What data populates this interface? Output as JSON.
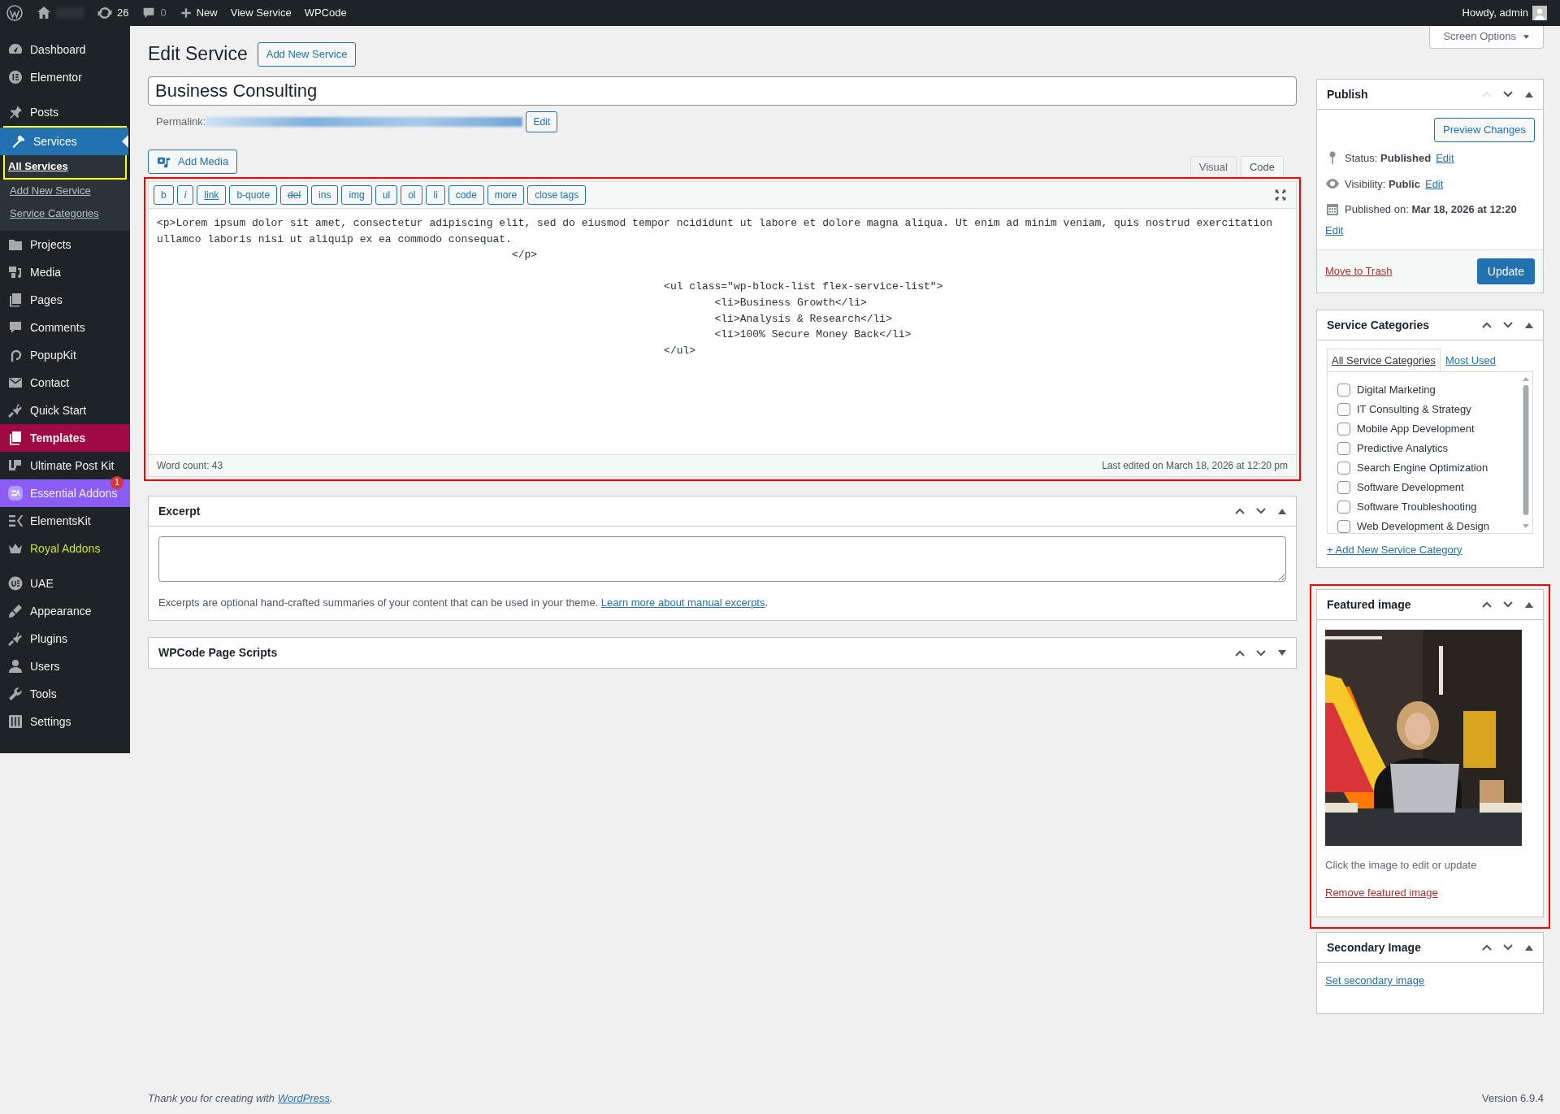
{
  "admin_bar": {
    "updates": "26",
    "comments": "0",
    "new": "New",
    "links": [
      "View Service",
      "WPCode"
    ],
    "greeting": "Howdy, admin"
  },
  "sidebar": {
    "groups": [
      {
        "items": [
          {
            "label": "Dashboard",
            "kind": "plain",
            "selected": false
          },
          {
            "label": "Elementor",
            "kind": "plain",
            "selected": false
          }
        ]
      },
      {
        "items": [
          {
            "label": "Posts",
            "kind": "plain",
            "selected": false
          },
          {
            "label": "Services",
            "kind": "plain",
            "selected": true,
            "highlighted": true,
            "children": [
              {
                "label": "All Services",
                "selected": true
              },
              {
                "label": "Add New Service",
                "selected": false
              },
              {
                "label": "Service Categories",
                "selected": false
              }
            ]
          },
          {
            "label": "Projects",
            "kind": "plain",
            "selected": false
          },
          {
            "label": "Media",
            "kind": "plain",
            "selected": false
          },
          {
            "label": "Pages",
            "kind": "plain",
            "selected": false
          },
          {
            "label": "Comments",
            "kind": "plain",
            "selected": false
          },
          {
            "label": "PopupKit",
            "kind": "plain",
            "selected": false
          },
          {
            "label": "Contact",
            "kind": "plain",
            "selected": false
          },
          {
            "label": "Quick Start",
            "kind": "plain",
            "selected": false
          },
          {
            "label": "Templates",
            "kind": "banner",
            "color": "#9e0a41",
            "selected": false
          },
          {
            "label": "Ultimate Post Kit",
            "kind": "plain",
            "selected": false
          },
          {
            "label": "Essential Addons",
            "kind": "banner",
            "color": "#8b5cf6",
            "badge": "1",
            "selected": false
          },
          {
            "label": "ElementsKit",
            "kind": "plain",
            "selected": false
          },
          {
            "label": "Royal Addons",
            "kind": "colored-text",
            "color": "#c7e23a",
            "selected": false
          }
        ]
      },
      {
        "items": [
          {
            "label": "UAE",
            "kind": "plain",
            "selected": false
          },
          {
            "label": "Appearance",
            "kind": "plain",
            "selected": false
          },
          {
            "label": "Plugins",
            "kind": "plain",
            "selected": false
          },
          {
            "label": "Users",
            "kind": "plain",
            "selected": false
          },
          {
            "label": "Tools",
            "kind": "plain",
            "selected": false
          },
          {
            "label": "Settings",
            "kind": "plain",
            "selected": false
          }
        ]
      }
    ]
  },
  "heading": "Edit Service",
  "add_new_button": "Add New Service",
  "screen_options": "Screen Options",
  "title_field": {
    "value": "Business Consulting"
  },
  "permalink": {
    "label": "Permalink:",
    "edit_button": "Edit"
  },
  "add_media": "Add Media",
  "editor": {
    "highlighted": true,
    "tabs": [
      {
        "label": "Visual",
        "selected": false
      },
      {
        "label": "Code",
        "selected": true
      }
    ],
    "quicktags": [
      {
        "label": "b",
        "kind": "plain"
      },
      {
        "label": "i",
        "kind": "italic"
      },
      {
        "label": "link",
        "kind": "underline"
      },
      {
        "label": "b-quote",
        "kind": "plain"
      },
      {
        "label": "del",
        "kind": "strike"
      },
      {
        "label": "ins",
        "kind": "plain"
      },
      {
        "label": "img",
        "kind": "plain"
      },
      {
        "label": "ul",
        "kind": "plain"
      },
      {
        "label": "ol",
        "kind": "plain"
      },
      {
        "label": "li",
        "kind": "plain"
      },
      {
        "label": "code",
        "kind": "plain"
      },
      {
        "label": "more",
        "kind": "plain"
      },
      {
        "label": "close tags",
        "kind": "plain"
      }
    ],
    "content": "<p>Lorem ipsum dolor sit amet, consectetur adipiscing elit, sed do eiusmod tempor ncididunt ut labore et dolore magna aliqua. Ut enim ad minim veniam, quis nostrud exercitation ullamco laboris nisi ut aliquip ex ea commodo consequat.\n\t\t\t\t\t\t\t</p>\n\n\t\t\t\t\t\t\t\t\t\t<ul class=\"wp-block-list flex-service-list\">\n\t\t\t\t\t\t\t\t\t\t\t<li>Business Growth</li>\n\t\t\t\t\t\t\t\t\t\t\t<li>Analysis & Research</li>\n\t\t\t\t\t\t\t\t\t\t\t<li>100% Secure Money Back</li>\n\t\t\t\t\t\t\t\t\t\t</ul>",
    "word_count": "Word count: 43",
    "last_edited": "Last edited on March 18, 2026 at 12:20 pm"
  },
  "main_boxes": [
    {
      "kind": "excerpt",
      "title": "Excerpt",
      "expanded": true,
      "move_up_disabled": false,
      "help": "Excerpts are optional hand-crafted summaries of your content that can be used in your theme. ",
      "link": "Learn more about manual excerpts",
      "after": "."
    },
    {
      "kind": "plain",
      "title": "WPCode Page Scripts",
      "expanded": false,
      "move_up_disabled": false
    }
  ],
  "side_boxes": [
    {
      "kind": "publish",
      "title": "Publish",
      "expanded": true,
      "move_up_disabled": true,
      "preview_button": "Preview Changes",
      "rows": [
        {
          "kind": "status",
          "label": "Status:",
          "value": "Published",
          "link": "Edit"
        },
        {
          "kind": "visibility",
          "label": "Visibility:",
          "value": "Public",
          "link": "Edit"
        },
        {
          "kind": "date",
          "label": "Published on:",
          "value": "Mar 18, 2026 at 12:20",
          "link": "Edit"
        }
      ],
      "trash_link": "Move to Trash",
      "update_button": "Update"
    },
    {
      "kind": "categories",
      "title": "Service Categories",
      "expanded": true,
      "move_up_disabled": false,
      "tabs": [
        {
          "label": "All Service Categories",
          "selected": true
        },
        {
          "label": "Most Used",
          "selected": false
        }
      ],
      "items": [
        {
          "label": "Digital Marketing",
          "checked": false
        },
        {
          "label": "IT Consulting & Strategy",
          "checked": false
        },
        {
          "label": "Mobile App Development",
          "checked": false
        },
        {
          "label": "Predictive Analytics",
          "checked": false
        },
        {
          "label": "Search Engine Optimization",
          "checked": false
        },
        {
          "label": "Software Development",
          "checked": false
        },
        {
          "label": "Software Troubleshooting",
          "checked": false
        },
        {
          "label": "Web Development & Design",
          "checked": false
        }
      ],
      "add_link": "+ Add New Service Category"
    },
    {
      "kind": "featured",
      "title": "Featured image",
      "expanded": true,
      "move_up_disabled": false,
      "highlighted": true,
      "hint": "Click the image to edit or update",
      "remove_link": "Remove featured image"
    },
    {
      "kind": "secondary",
      "title": "Secondary Image",
      "expanded": true,
      "move_up_disabled": false,
      "set_link": "Set secondary image"
    }
  ],
  "footer": {
    "before": "Thank you for creating with ",
    "link": "WordPress",
    "after": ".",
    "version": "Version 6.9.4"
  }
}
